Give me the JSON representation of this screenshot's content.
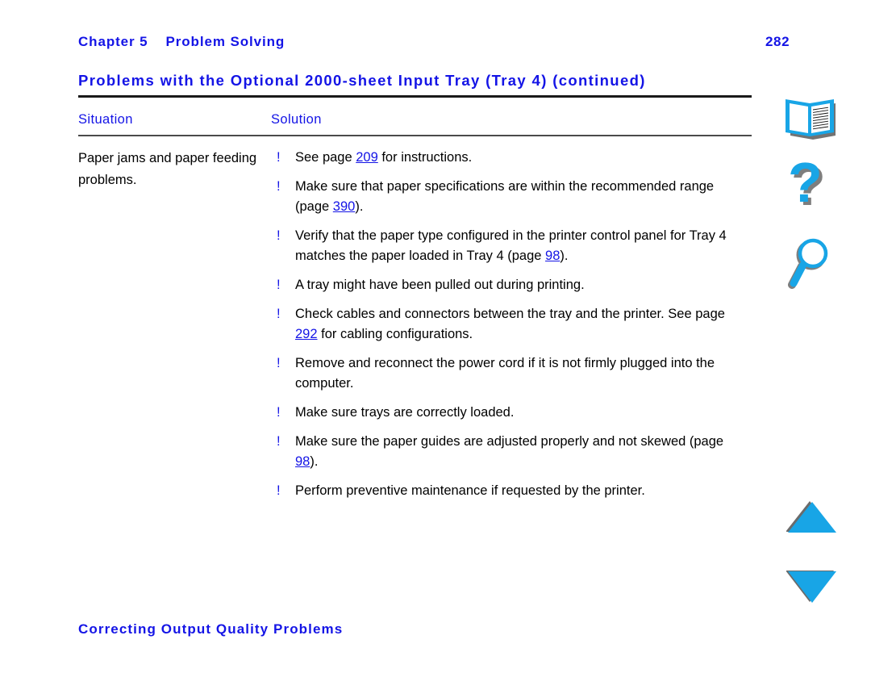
{
  "document": {
    "type": "printer-user-guide-page",
    "accent_color": "#1414e6",
    "icon_color": "#18a5e6",
    "text_color": "#000000"
  },
  "running_header": {
    "chapter_label": "Chapter 5",
    "chapter_title": "Problem Solving",
    "page_number": "282"
  },
  "section": {
    "title": "Problems with the Optional 2000-sheet Input Tray (Tray 4) (continued)"
  },
  "table": {
    "columns": [
      "Situation",
      "Solution"
    ],
    "rows": [
      {
        "situation": "Paper jams and paper feeding problems.",
        "bullet_mark": "!",
        "solutions": [
          {
            "parts": [
              {
                "text": "See page ",
                "link": false
              },
              {
                "text": "209",
                "link": true
              },
              {
                "text": " for instructions.",
                "link": false
              }
            ]
          },
          {
            "parts": [
              {
                "text": "Make sure that paper specifications are within the recommended range (page ",
                "link": false
              },
              {
                "text": "390",
                "link": true
              },
              {
                "text": ").",
                "link": false
              }
            ]
          },
          {
            "parts": [
              {
                "text": "Verify that the paper type configured in the printer control panel for Tray 4 matches the paper loaded in Tray 4 (page ",
                "link": false
              },
              {
                "text": "98",
                "link": true
              },
              {
                "text": ").",
                "link": false
              }
            ]
          },
          {
            "parts": [
              {
                "text": "A tray might have been pulled out during printing.",
                "link": false
              }
            ]
          },
          {
            "parts": [
              {
                "text": "Check cables and connectors between the tray and the printer. See page ",
                "link": false
              },
              {
                "text": "292",
                "link": true
              },
              {
                "text": " for cabling configurations.",
                "link": false
              }
            ]
          },
          {
            "parts": [
              {
                "text": "Remove and reconnect the power cord if it is not firmly plugged into the computer.",
                "link": false
              }
            ]
          },
          {
            "parts": [
              {
                "text": "Make sure trays are correctly loaded.",
                "link": false
              }
            ]
          },
          {
            "parts": [
              {
                "text": "Make sure the paper guides are adjusted properly and not skewed (page ",
                "link": false
              },
              {
                "text": "98",
                "link": true
              },
              {
                "text": ").",
                "link": false
              }
            ]
          },
          {
            "parts": [
              {
                "text": "Perform preventive maintenance if requested by the printer.",
                "link": false
              }
            ]
          }
        ]
      }
    ]
  },
  "footer": {
    "title": "Correcting Output Quality Problems"
  },
  "icon_rail": {
    "items": [
      {
        "name": "book-icon",
        "label": "Contents"
      },
      {
        "name": "question-mark-icon",
        "label": "Help"
      },
      {
        "name": "magnifier-icon",
        "label": "Search"
      },
      {
        "name": "arrow-up-icon",
        "label": "Previous page"
      },
      {
        "name": "arrow-down-icon",
        "label": "Next page"
      }
    ]
  }
}
